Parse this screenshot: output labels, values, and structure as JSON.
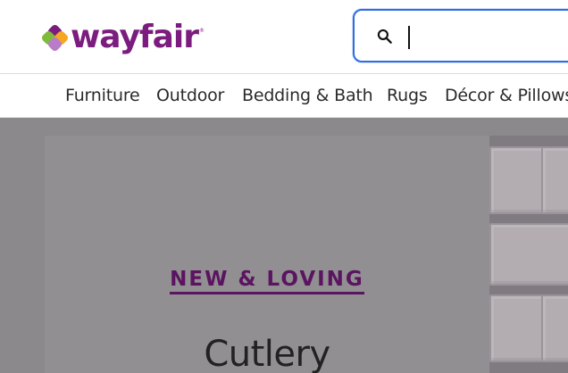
{
  "brand": {
    "name": "wayfair",
    "trademark": "®",
    "colors": {
      "wordmark": "#7b1c7f",
      "mark_green": "#7fba3a",
      "mark_orange": "#f5a623",
      "mark_purple": "#7b1c7f",
      "mark_lilac": "#b87cc8"
    }
  },
  "search": {
    "value": "",
    "focused": true,
    "icon": "search-icon",
    "accent": "#2f6ee0"
  },
  "nav": {
    "items": [
      {
        "label": "Furniture"
      },
      {
        "label": "Outdoor"
      },
      {
        "label": "Bedding & Bath"
      },
      {
        "label": "Rugs"
      },
      {
        "label": "Décor & Pillows"
      }
    ]
  },
  "hero": {
    "eyebrow": "NEW & LOVING",
    "title": "Cutlery",
    "eyebrow_color": "#5b1460"
  }
}
